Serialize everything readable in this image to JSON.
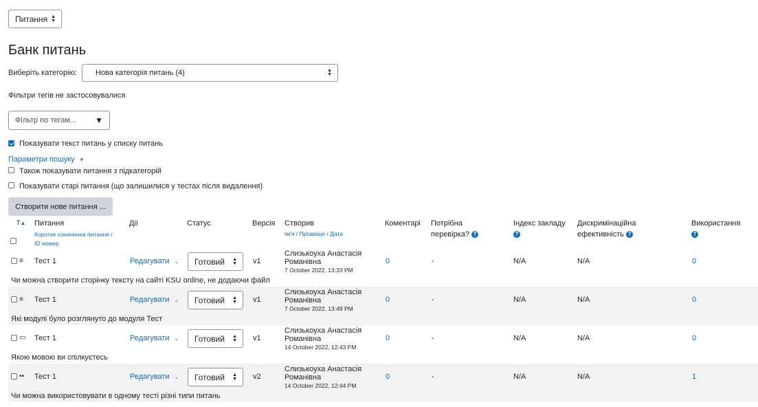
{
  "top_select": {
    "label": "Питання"
  },
  "page_title": "Банк питань",
  "category": {
    "label": "Виберіть категорію:",
    "value": "Нова категорія питань (4)"
  },
  "tag_filter_note": "Фільтри тегів не застосовувалися",
  "tag_filter": {
    "placeholder": "Фільтр по тегам..."
  },
  "show_text_label": "Показувати текст питань у списку питань",
  "search_params_label": "Параметри пошуку",
  "subcat_label": "Також показувати питання з підкатегорій",
  "old_label": "Показувати старі питання (що залишилися у тестах після видалення)",
  "create_button": "Створити нове питання ...",
  "columns": {
    "sort": "T",
    "question": "Питання",
    "question_sub": "Коротке означення питання /",
    "question_sub2": "ID номер",
    "actions": "Дії",
    "status": "Статус",
    "version": "Версія",
    "creator": "Створив",
    "creator_sub_name": "Ім'я",
    "creator_sub_sep1": " / ",
    "creator_sub_surname": "Прізвище",
    "creator_sub_sep2": " / ",
    "creator_sub_date": "Дата",
    "comments": "Коментарі",
    "review1": "Потрібна",
    "review2": "перевірка?",
    "facility1": "Індекс закладу",
    "discrim1": "Дискримінаційна",
    "discrim2": "ефективність",
    "usage": "Використання"
  },
  "rows": [
    {
      "icon": "≡",
      "name": "Тест 1",
      "action": "Редагувати",
      "status": "Готовий",
      "version": "v1",
      "creator1": "Слизькоуха Анастасія",
      "creator2": "Романівна",
      "date": "7 October 2022, 13:33 PM",
      "comments": "0",
      "review": "-",
      "facility": "N/A",
      "discrim": "N/A",
      "usage": "0",
      "text": "Чи можна створити сторінку тексту на сайті KSU online, не додаючи файл"
    },
    {
      "icon": "≡",
      "name": "Тест 1",
      "action": "Редагувати",
      "status": "Готовий",
      "version": "v1",
      "creator1": "Слизькоуха Анастасія",
      "creator2": "Романівна",
      "date": "7 October 2022, 13:49 PM",
      "comments": "0",
      "review": "-",
      "facility": "N/A",
      "discrim": "N/A",
      "usage": "0",
      "text": "Які модулі було розглянуто до модуля Тест"
    },
    {
      "icon": "▭",
      "name": "Тест 1",
      "action": "Редагувати",
      "status": "Готовий",
      "version": "v1",
      "creator1": "Слизькоуха Анастасія",
      "creator2": "Романівна",
      "date": "14 October 2022, 12:43 PM",
      "comments": "0",
      "review": "-",
      "facility": "N/A",
      "discrim": "N/A",
      "usage": "0",
      "text": "Якою мовою ви спілкуєтесь"
    },
    {
      "icon": "••",
      "name": "Тест 1",
      "action": "Редагувати",
      "status": "Готовий",
      "version": "v2",
      "creator1": "Слизькоуха Анастасія",
      "creator2": "Романівна",
      "date": "14 October 2022, 12:44 PM",
      "comments": "0",
      "review": "-",
      "facility": "N/A",
      "discrim": "N/A",
      "usage": "1",
      "text": "Чи можна використовувати в одному тесті різні типи питань"
    }
  ],
  "colors": {
    "link": "#0f6cbf",
    "row_shade": "#f2f2f2",
    "button_bg": "#ced4da"
  }
}
